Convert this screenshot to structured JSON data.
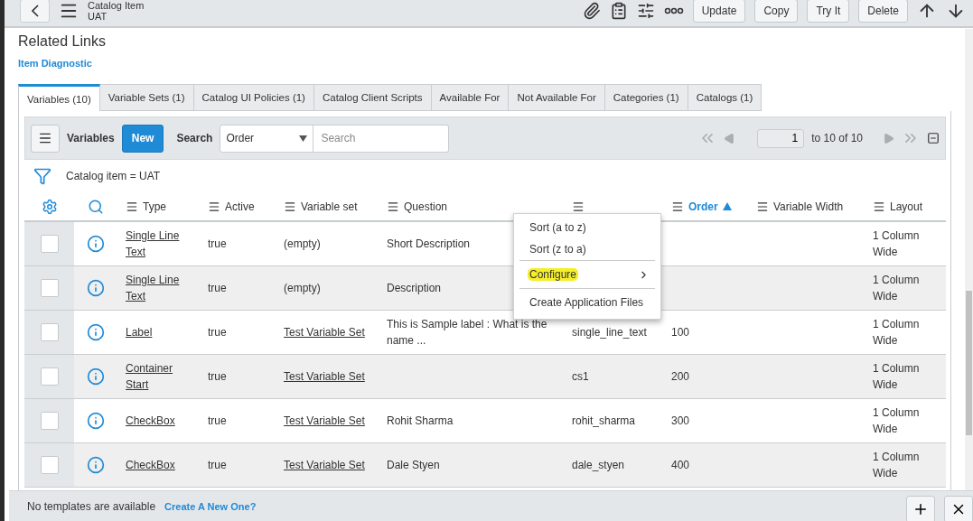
{
  "header": {
    "title": "Catalog Item",
    "subtitle": "UAT",
    "buttons": [
      "Update",
      "Copy",
      "Try It",
      "Delete"
    ]
  },
  "related_links": {
    "title": "Related Links",
    "links": [
      "Item Diagnostic"
    ]
  },
  "tabs": [
    {
      "label": "Variables (10)",
      "selected": true
    },
    {
      "label": "Variable Sets (1)",
      "selected": false
    },
    {
      "label": "Catalog UI Policies (1)",
      "selected": false
    },
    {
      "label": "Catalog Client Scripts",
      "selected": false
    },
    {
      "label": "Available For",
      "selected": false
    },
    {
      "label": "Not Available For",
      "selected": false
    },
    {
      "label": "Categories (1)",
      "selected": false
    },
    {
      "label": "Catalogs (1)",
      "selected": false
    }
  ],
  "list_toolbar": {
    "title": "Variables",
    "new_button": "New",
    "search_label": "Search",
    "field": "Order",
    "search_placeholder": "Search",
    "page": "1",
    "range": "to 10 of 10"
  },
  "filter": "Catalog item = UAT",
  "columns": [
    {
      "label": "Type",
      "sorted": false
    },
    {
      "label": "Active",
      "sorted": false
    },
    {
      "label": "Variable set",
      "sorted": false
    },
    {
      "label": "Question",
      "sorted": false
    },
    {
      "sorted": false
    },
    {
      "label": "Order",
      "sorted": true
    },
    {
      "label": "Variable Width",
      "sorted": false
    },
    {
      "label": "Layout",
      "sorted": false
    }
  ],
  "rows": [
    {
      "checked": false,
      "type": "Single Line Text",
      "active": "true",
      "variable_set": "(empty)",
      "variable_set_link": false,
      "question": "Short Description",
      "layout": "1 Column Wide"
    },
    {
      "checked": false,
      "type": "Single Line Text",
      "active": "true",
      "variable_set": "(empty)",
      "variable_set_link": false,
      "question": "Description",
      "layout": "1 Column Wide"
    },
    {
      "checked": false,
      "type": "Label",
      "active": "true",
      "variable_set": "Test Variable Set",
      "variable_set_link": true,
      "question": "This is Sample label : What is the name ...",
      "name": "single_line_text",
      "order": "100",
      "layout": "1 Column Wide"
    },
    {
      "checked": false,
      "type": "Container Start",
      "active": "true",
      "variable_set": "Test Variable Set",
      "variable_set_link": true,
      "name": "cs1",
      "order": "200",
      "layout": "1 Column Wide"
    },
    {
      "checked": false,
      "type": "CheckBox",
      "active": "true",
      "variable_set": "Test Variable Set",
      "variable_set_link": true,
      "question": "Rohit Sharma",
      "name": "rohit_sharma",
      "order": "300",
      "layout": "1 Column Wide"
    },
    {
      "checked": false,
      "type": "CheckBox",
      "active": "true",
      "variable_set": "Test Variable Set",
      "variable_set_link": true,
      "question": "Dale Styen",
      "name": "dale_styen",
      "order": "400",
      "layout": "1 Column Wide"
    }
  ],
  "context_menu": {
    "items": [
      {
        "label": "Sort (a to z)",
        "kind": "item",
        "separator_before": false,
        "highlighted": false
      },
      {
        "label": "Sort (z to a)",
        "kind": "item",
        "separator_before": false,
        "highlighted": false
      },
      {
        "label": "Configure",
        "kind": "submenu",
        "separator_before": true,
        "highlighted": true
      },
      {
        "label": "Create Application Files",
        "kind": "item",
        "separator_before": true,
        "highlighted": false
      }
    ]
  },
  "footer": {
    "message": "No templates are available",
    "link": "Create A New One?"
  }
}
